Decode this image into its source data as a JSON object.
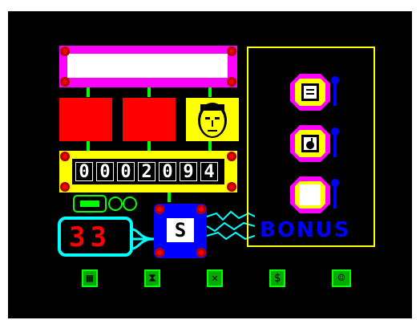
{
  "score": {
    "digits": [
      "0",
      "0",
      "0",
      "2",
      "0",
      "9",
      "4"
    ],
    "display": "0002094"
  },
  "timer": {
    "value": "33"
  },
  "selected_slot": {
    "label": "S"
  },
  "bonus": {
    "label": "BONUS"
  },
  "status_bar_text": "",
  "colors": {
    "background": "#000000",
    "magenta": "#ff00ff",
    "yellow": "#ffff00",
    "red": "#ff0000",
    "green": "#00ff00",
    "cyan": "#00ffff",
    "blue": "#0000ff"
  },
  "bonus_slots": [
    {
      "icon": "picture-icon"
    },
    {
      "icon": "bomb-icon"
    },
    {
      "icon": "empty-slot"
    }
  ],
  "bottom_icons": [
    {
      "name": "map-icon"
    },
    {
      "name": "hourglass-icon"
    },
    {
      "name": "tools-icon"
    },
    {
      "name": "money-icon"
    },
    {
      "name": "robot-face-icon"
    }
  ]
}
